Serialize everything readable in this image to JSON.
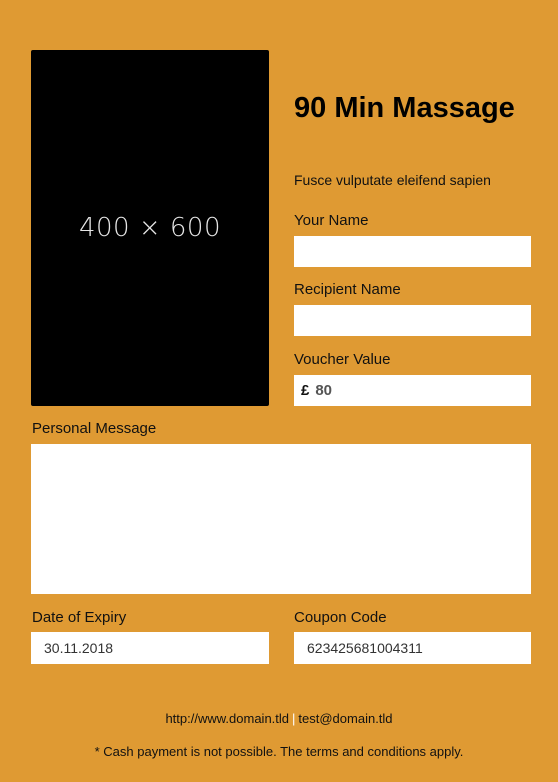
{
  "image_placeholder": {
    "text": "400 × 600"
  },
  "product": {
    "title": "90 Min Massage",
    "subtitle": "Fusce vulputate eleifend sapien"
  },
  "form": {
    "your_name": {
      "label": "Your Name",
      "value": ""
    },
    "recipient_name": {
      "label": "Recipient Name",
      "value": ""
    },
    "voucher_value": {
      "label": "Voucher Value",
      "currency_symbol": "£",
      "value": "80"
    },
    "personal_message": {
      "label": "Personal Message",
      "value": ""
    },
    "date_of_expiry": {
      "label": "Date of Expiry",
      "value": "30.11.2018"
    },
    "coupon_code": {
      "label": "Coupon Code",
      "value": "623425681004311"
    }
  },
  "footer": {
    "website": "http://www.domain.tld",
    "separator": "|",
    "email": "test@domain.tld",
    "note": "* Cash payment is not possible. The terms and conditions apply."
  },
  "colors": {
    "background": "#df9a33",
    "field_background": "#ffffff",
    "image_placeholder": "#000000"
  }
}
